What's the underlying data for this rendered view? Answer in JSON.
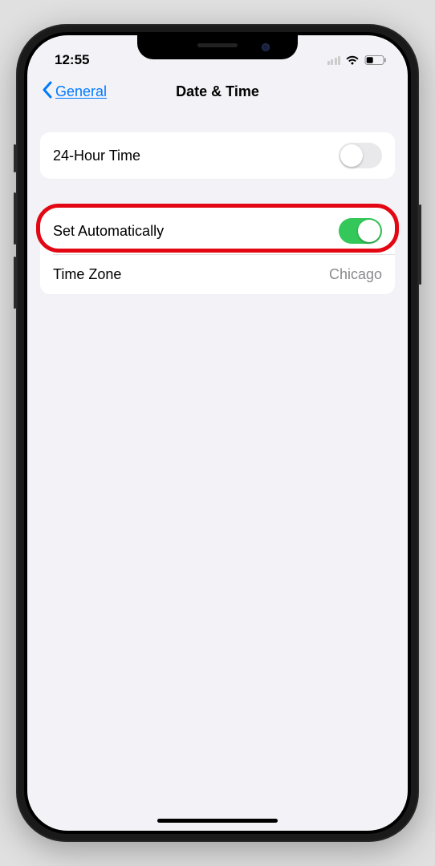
{
  "status": {
    "time": "12:55"
  },
  "nav": {
    "back_label": "General",
    "title": "Date & Time"
  },
  "settings": {
    "group1": {
      "row1": {
        "label": "24-Hour Time",
        "enabled": false
      }
    },
    "group2": {
      "row1": {
        "label": "Set Automatically",
        "enabled": true,
        "highlighted": true
      },
      "row2": {
        "label": "Time Zone",
        "value": "Chicago"
      }
    }
  }
}
